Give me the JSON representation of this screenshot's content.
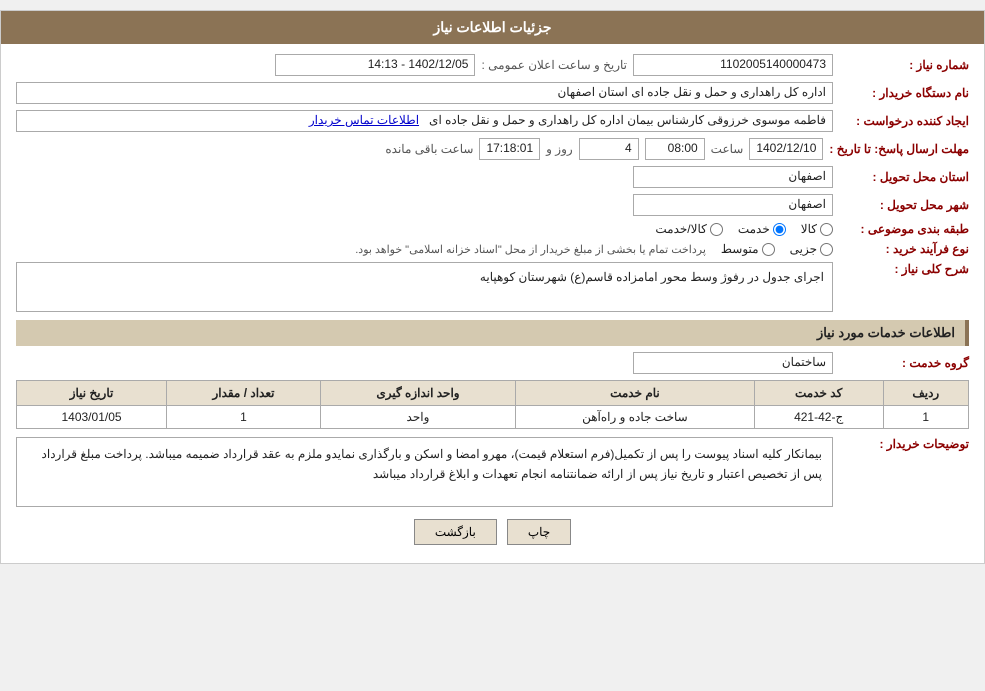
{
  "header": {
    "title": "جزئیات اطلاعات نیاز"
  },
  "fields": {
    "need_number_label": "شماره نیاز :",
    "need_number_value": "1102005140000473",
    "announcement_label": "تاریخ و ساعت اعلان عمومی :",
    "announcement_value": "1402/12/05 - 14:13",
    "buyer_name_label": "نام دستگاه خریدار :",
    "buyer_name_value": "اداره کل راهداری و حمل و نقل جاده ای استان اصفهان",
    "requester_label": "ایجاد کننده درخواست :",
    "requester_value": "فاطمه موسوی خرزوقی کارشناس بیمان اداره کل راهداری و حمل و نقل جاده ای",
    "contact_link": "اطلاعات تماس خریدار",
    "response_deadline_label": "مهلت ارسال پاسخ: تا تاریخ :",
    "response_date_value": "1402/12/10",
    "response_time_label": "ساعت",
    "response_time_value": "08:00",
    "response_days_label": "روز و",
    "response_days_value": "4",
    "response_remaining_label": "ساعت باقی مانده",
    "response_remaining_value": "17:18:01",
    "province_label": "استان محل تحویل :",
    "province_value": "اصفهان",
    "city_label": "شهر محل تحویل :",
    "city_value": "اصفهان",
    "category_label": "طبقه بندی موضوعی :",
    "category_options": [
      "کالا",
      "خدمت",
      "کالا/خدمت"
    ],
    "category_selected": "خدمت",
    "purchase_type_label": "نوع فرآیند خرید :",
    "purchase_type_options": [
      "جزیی",
      "متوسط"
    ],
    "purchase_type_note": "پرداخت تمام یا بخشی از مبلغ خریدار از محل \"اسناد خزانه اسلامی\" خواهد بود.",
    "need_description_label": "شرح کلی نیاز :",
    "need_description_value": "اجرای جدول در رفوژ وسط محور امامزاده قاسم(ع) شهرستان کوهپایه",
    "service_info_header": "اطلاعات خدمات مورد نیاز",
    "service_group_label": "گروه خدمت :",
    "service_group_value": "ساختمان",
    "table": {
      "headers": [
        "ردیف",
        "کد خدمت",
        "نام خدمت",
        "واحد اندازه گیری",
        "تعداد / مقدار",
        "تاریخ نیاز"
      ],
      "rows": [
        {
          "row": "1",
          "code": "ج-42-421",
          "name": "ساخت جاده و راه‌آهن",
          "unit": "واحد",
          "quantity": "1",
          "date": "1403/01/05"
        }
      ]
    },
    "buyer_notes_label": "توضیحات خریدار :",
    "buyer_notes_value": "بیمانکار کلیه اسناد پیوست را پس از تکمیل(فرم استعلام قیمت)، مهرو امضا و اسکن و بارگذاری نمایدو ملزم به عقد قرارداد ضمیمه میباشد. پرداخت مبلغ قرارداد پس از تخصیص اعتبار و تاریخ نیاز پس از ارائه ضمانتنامه انجام تعهدات و ابلاغ قرارداد میباشد",
    "back_button": "بازگشت",
    "print_button": "چاپ"
  }
}
